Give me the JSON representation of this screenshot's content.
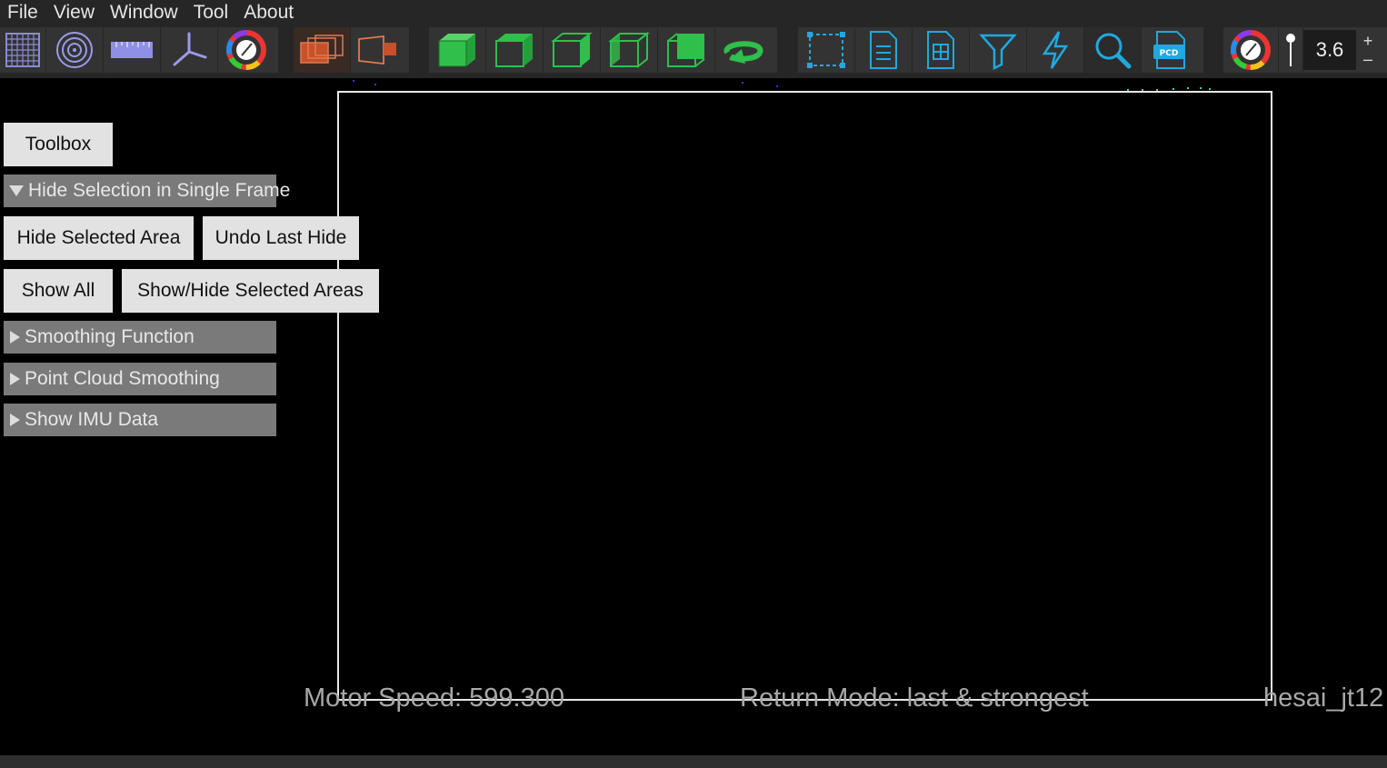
{
  "menu": [
    "File",
    "View",
    "Window",
    "Tool",
    "About"
  ],
  "toolbar": {
    "groups": [
      [
        "grid-icon",
        "rings-icon",
        "ruler-icon",
        "axes-icon",
        "color-wheel-icon"
      ],
      [
        "frame-stack-icon",
        "camera-frustum-icon"
      ],
      [
        "cube-front-icon",
        "cube-top-icon",
        "cube-side-icon",
        "cube-iso-icon",
        "cube-back-icon",
        "rotate-icon"
      ],
      [
        "select-rect-icon",
        "list-doc-icon",
        "table-doc-icon",
        "filter-icon",
        "lightning-icon",
        "search-icon",
        "pcd-file-icon"
      ],
      [
        "color-wheel-icon",
        "point-size-icon"
      ]
    ],
    "point_size": "3.6",
    "plus": "+",
    "minus": "–"
  },
  "panel": {
    "toolbox": "Toolbox",
    "section_hide": "Hide Selection in Single Frame",
    "hide_selected": "Hide Selected Area",
    "undo_last_hide": "Undo Last Hide",
    "show_all": "Show All",
    "show_hide_selected": "Show/Hide Selected Areas",
    "section_smoothing": "Smoothing Function",
    "section_pc_smoothing": "Point Cloud Smoothing",
    "section_imu": "Show IMU Data"
  },
  "status": {
    "motor_speed": "Motor Speed:   599.300",
    "return_mode": "Return Mode: last & strongest",
    "device": "hesai_jt12"
  },
  "colors": {
    "accent_blue": "#1fa9e0",
    "cube_green": "#2fbf4a",
    "frame_orange": "#c8502a"
  }
}
